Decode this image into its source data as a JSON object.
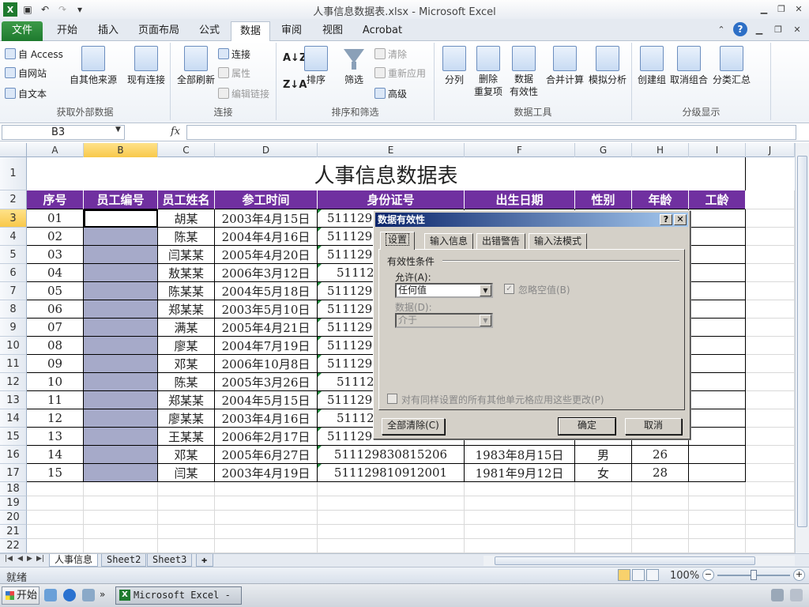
{
  "window": {
    "title": "人事信息数据表.xlsx - Microsoft Excel"
  },
  "tabs": [
    {
      "label": "文件",
      "name": "tab-file"
    },
    {
      "label": "开始",
      "name": "tab-home"
    },
    {
      "label": "插入",
      "name": "tab-insert"
    },
    {
      "label": "页面布局",
      "name": "tab-page-layout"
    },
    {
      "label": "公式",
      "name": "tab-formulas"
    },
    {
      "label": "数据",
      "name": "tab-data",
      "active": true
    },
    {
      "label": "审阅",
      "name": "tab-review"
    },
    {
      "label": "视图",
      "name": "tab-view"
    },
    {
      "label": "Acrobat",
      "name": "tab-acrobat"
    }
  ],
  "ribbon": {
    "get_external": {
      "access": "自 Access",
      "web": "自网站",
      "text": "自文本",
      "other": "自其他来源",
      "existing": "现有连接",
      "label": "获取外部数据"
    },
    "connections": {
      "refresh_all": "全部刷新",
      "connections": "连接",
      "properties": "属性",
      "edit_links": "编辑链接",
      "label": "连接"
    },
    "sort_filter": {
      "sort": "排序",
      "filter": "筛选",
      "clear": "清除",
      "reapply": "重新应用",
      "advanced": "高级",
      "label": "排序和筛选"
    },
    "data_tools": {
      "text_to_columns": "分列",
      "remove_dup_1": "删除",
      "remove_dup_2": "重复项",
      "validation_1": "数据",
      "validation_2": "有效性",
      "consolidate": "合并计算",
      "what_if": "模拟分析",
      "label": "数据工具"
    },
    "outline": {
      "group": "创建组",
      "ungroup": "取消组合",
      "subtotal": "分类汇总",
      "label": "分级显示"
    }
  },
  "formula_bar": {
    "name_box": "B3",
    "fx": "fx",
    "value": ""
  },
  "sheet": {
    "columns": [
      "A",
      "B",
      "C",
      "D",
      "E",
      "F",
      "G",
      "H",
      "I",
      "J"
    ],
    "rows": [
      "1",
      "2",
      "3",
      "4",
      "5",
      "6",
      "7",
      "8",
      "9",
      "10",
      "11",
      "12",
      "13",
      "14",
      "15",
      "16",
      "17",
      "18",
      "19",
      "20",
      "21",
      "22"
    ],
    "title": "人事信息数据表",
    "headers": [
      "序号",
      "员工编号",
      "员工姓名",
      "参工时间",
      "身份证号",
      "出生日期",
      "性别",
      "年龄",
      "工龄"
    ],
    "data": [
      {
        "seq": "01",
        "name": "胡某",
        "date": "2003年4月15日",
        "id": "511129"
      },
      {
        "seq": "02",
        "name": "陈某",
        "date": "2004年4月16日",
        "id": "511129"
      },
      {
        "seq": "03",
        "name": "闫某某",
        "date": "2005年4月20日",
        "id": "511129"
      },
      {
        "seq": "04",
        "name": "敖某某",
        "date": "2006年3月12日",
        "id": "51112"
      },
      {
        "seq": "05",
        "name": "陈某某",
        "date": "2004年5月18日",
        "id": "511129"
      },
      {
        "seq": "06",
        "name": "郑某某",
        "date": "2003年5月10日",
        "id": "511129"
      },
      {
        "seq": "07",
        "name": "满某",
        "date": "2005年4月21日",
        "id": "511129"
      },
      {
        "seq": "08",
        "name": "廖某",
        "date": "2004年7月19日",
        "id": "511129"
      },
      {
        "seq": "09",
        "name": "邓某",
        "date": "2006年10月8日",
        "id": "511129"
      },
      {
        "seq": "10",
        "name": "陈某",
        "date": "2005年3月26日",
        "id": "51112"
      },
      {
        "seq": "11",
        "name": "郑某某",
        "date": "2004年5月15日",
        "id": "511129"
      },
      {
        "seq": "12",
        "name": "廖某某",
        "date": "2003年4月16日",
        "id": "51112"
      },
      {
        "seq": "13",
        "name": "王某某",
        "date": "2006年2月17日",
        "id": "511129"
      },
      {
        "seq": "14",
        "name": "邓某",
        "date": "2005年6月27日",
        "id": "51112983081520​6",
        "birth": "1983年8月15日",
        "gender": "男",
        "age": "26"
      },
      {
        "seq": "15",
        "name": "闫某",
        "date": "2003年4月19日",
        "id": "511129810912001",
        "birth": "1981年9月12日",
        "gender": "女",
        "age": "28"
      }
    ]
  },
  "sheet_tabs": [
    "人事信息",
    "Sheet2",
    "Sheet3"
  ],
  "status": {
    "ready": "就绪",
    "zoom": "100%"
  },
  "taskbar": {
    "start": "开始",
    "excel_task": "Microsoft Excel - ..."
  },
  "dialog": {
    "title": "数据有效性",
    "help": "?",
    "close": "✕",
    "tabs": [
      "设置",
      "输入信息",
      "出错警告",
      "输入法模式"
    ],
    "criteria_label": "有效性条件",
    "allow_label": "允许(A):",
    "allow_value": "任何值",
    "ignore_blank": "忽略空值(B)",
    "data_label": "数据(D):",
    "data_value": "介于",
    "apply_all": "对有同样设置的所有其他单元格应用这些更改(P)",
    "clear_all": "全部清除(C)",
    "ok": "确定",
    "cancel": "取消"
  }
}
